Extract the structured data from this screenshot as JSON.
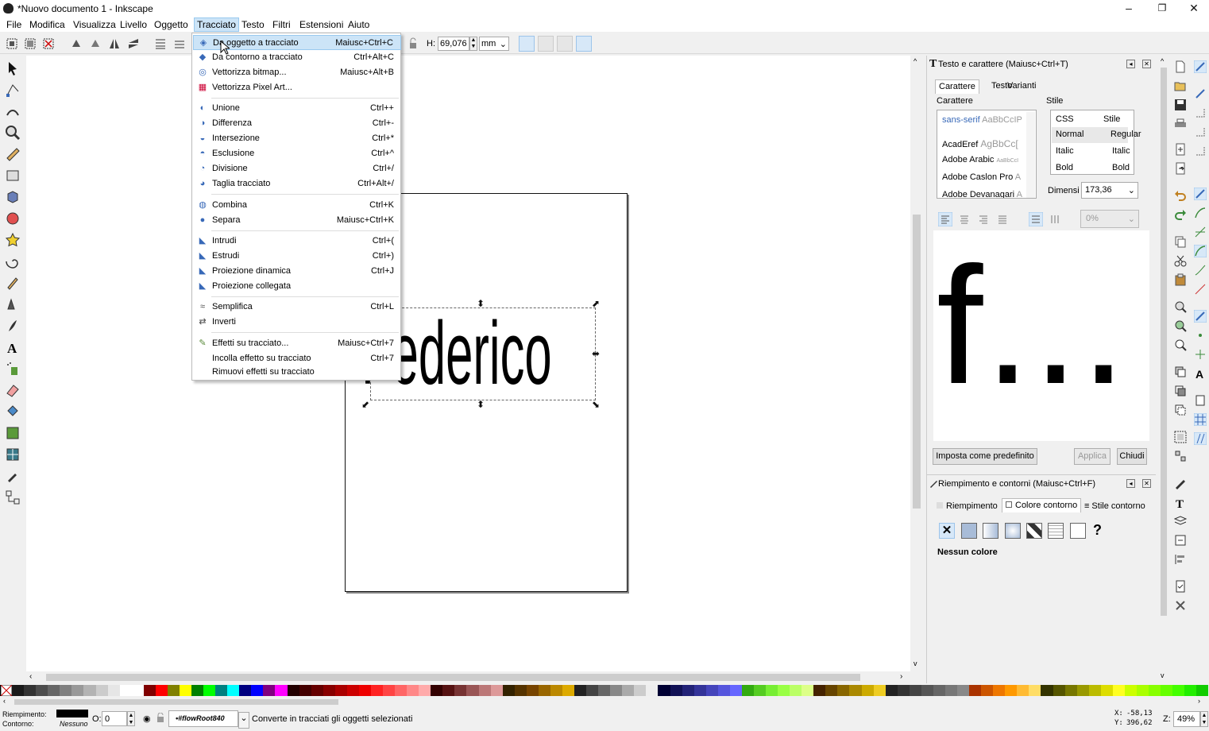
{
  "window": {
    "title": "*Nuovo documento 1 - Inkscape",
    "minimize": "–",
    "restore": "❐",
    "close": "✕"
  },
  "menubar": {
    "items": [
      "File",
      "Modifica",
      "Visualizza",
      "Livello",
      "Oggetto",
      "Tracciato",
      "Testo",
      "Filtri",
      "Estensioni",
      "Aiuto"
    ],
    "open_item": "Tracciato"
  },
  "toolbar": {
    "h_label": "H:",
    "h_value": "69,076",
    "unit": "mm"
  },
  "path_menu": {
    "items": [
      {
        "label": "Da oggetto a tracciato",
        "shortcut": "Maiusc+Ctrl+C",
        "icon": "object-to-path-icon",
        "highlighted": true
      },
      {
        "label": "Da contorno a tracciato",
        "shortcut": "Ctrl+Alt+C",
        "icon": "stroke-to-path-icon"
      },
      {
        "label": "Vettorizza bitmap...",
        "shortcut": "Maiusc+Alt+B",
        "icon": "trace-bitmap-icon"
      },
      {
        "label": "Vettorizza Pixel Art...",
        "shortcut": "",
        "icon": "trace-pixel-art-icon"
      },
      {
        "sep": true
      },
      {
        "label": "Unione",
        "shortcut": "Ctrl++",
        "icon": "union-icon"
      },
      {
        "label": "Differenza",
        "shortcut": "Ctrl+-",
        "icon": "difference-icon"
      },
      {
        "label": "Intersezione",
        "shortcut": "Ctrl+*",
        "icon": "intersection-icon"
      },
      {
        "label": "Esclusione",
        "shortcut": "Ctrl+^",
        "icon": "exclusion-icon"
      },
      {
        "label": "Divisione",
        "shortcut": "Ctrl+/",
        "icon": "division-icon"
      },
      {
        "label": "Taglia tracciato",
        "shortcut": "Ctrl+Alt+/",
        "icon": "cut-path-icon"
      },
      {
        "sep": true
      },
      {
        "label": "Combina",
        "shortcut": "Ctrl+K",
        "icon": "combine-icon"
      },
      {
        "label": "Separa",
        "shortcut": "Maiusc+Ctrl+K",
        "icon": "break-apart-icon"
      },
      {
        "sep": true
      },
      {
        "label": "Intrudi",
        "shortcut": "Ctrl+(",
        "icon": "inset-icon"
      },
      {
        "label": "Estrudi",
        "shortcut": "Ctrl+)",
        "icon": "outset-icon"
      },
      {
        "label": "Proiezione dinamica",
        "shortcut": "Ctrl+J",
        "icon": "dynamic-offset-icon"
      },
      {
        "label": "Proiezione collegata",
        "shortcut": "",
        "icon": "linked-offset-icon"
      },
      {
        "sep": true
      },
      {
        "label": "Semplifica",
        "shortcut": "Ctrl+L",
        "icon": "simplify-icon"
      },
      {
        "label": "Inverti",
        "shortcut": "",
        "icon": "reverse-icon"
      },
      {
        "sep": true
      },
      {
        "label": "Effetti su tracciato...",
        "shortcut": "Maiusc+Ctrl+7",
        "icon": "path-effects-icon"
      },
      {
        "label": "Incolla effetto su tracciato",
        "shortcut": "Ctrl+7",
        "icon": ""
      },
      {
        "label": "Rimuovi effetti su tracciato",
        "shortcut": "",
        "icon": ""
      }
    ]
  },
  "canvas": {
    "text": "Federico"
  },
  "text_panel": {
    "title": "Testo e carattere (Maiusc+Ctrl+T)",
    "tabs": [
      "Carattere",
      "Testo",
      "Varianti"
    ],
    "font_group": "Carattere",
    "style_group": "Stile",
    "fonts": [
      {
        "name": "sans-serif",
        "sample": "AaBbCcIP"
      },
      {
        "name": "AcadEref",
        "sample": "AgBbCc["
      },
      {
        "name": "Adobe Arabic",
        "sample": "AaBbCcI"
      },
      {
        "name": "Adobe Caslon Pro",
        "sample": "A"
      },
      {
        "name": "Adobe Devanagari",
        "sample": "A"
      }
    ],
    "style_headers": [
      "CSS",
      "Stile"
    ],
    "styles": [
      {
        "css": "Normal",
        "face": "Regular"
      },
      {
        "css": "Italic",
        "face": "Italic"
      },
      {
        "css": "Bold",
        "face": "Bold"
      }
    ],
    "size_label": "Dimensi",
    "size_value": "173,36",
    "spacing_value": "0%",
    "preview": "f...",
    "btn_default": "Imposta come predefinito",
    "btn_apply": "Applica",
    "btn_close": "Chiudi"
  },
  "fill_panel": {
    "title": "Riempimento e contorni (Maiusc+Ctrl+F)",
    "tabs": [
      "Riempimento",
      "Colore contorno",
      "Stile contorno"
    ],
    "no_color": "Nessun colore",
    "unknown": "?"
  },
  "status": {
    "fill_label": "Riempimento:",
    "stroke_label": "Contorno:",
    "stroke_value": "Nessuno",
    "opacity_label": "O:",
    "opacity_value": "0",
    "layer": "•#flowRoot840",
    "message": "Converte in tracciati gli oggetti selezionati",
    "x_label": "X:",
    "x_value": "-58,13",
    "y_label": "Y:",
    "y_value": "396,62",
    "zoom_label": "Z:",
    "zoom_value": "49%"
  },
  "colors": {
    "accent": "#3869b8",
    "highlight": "#cce4f7"
  }
}
